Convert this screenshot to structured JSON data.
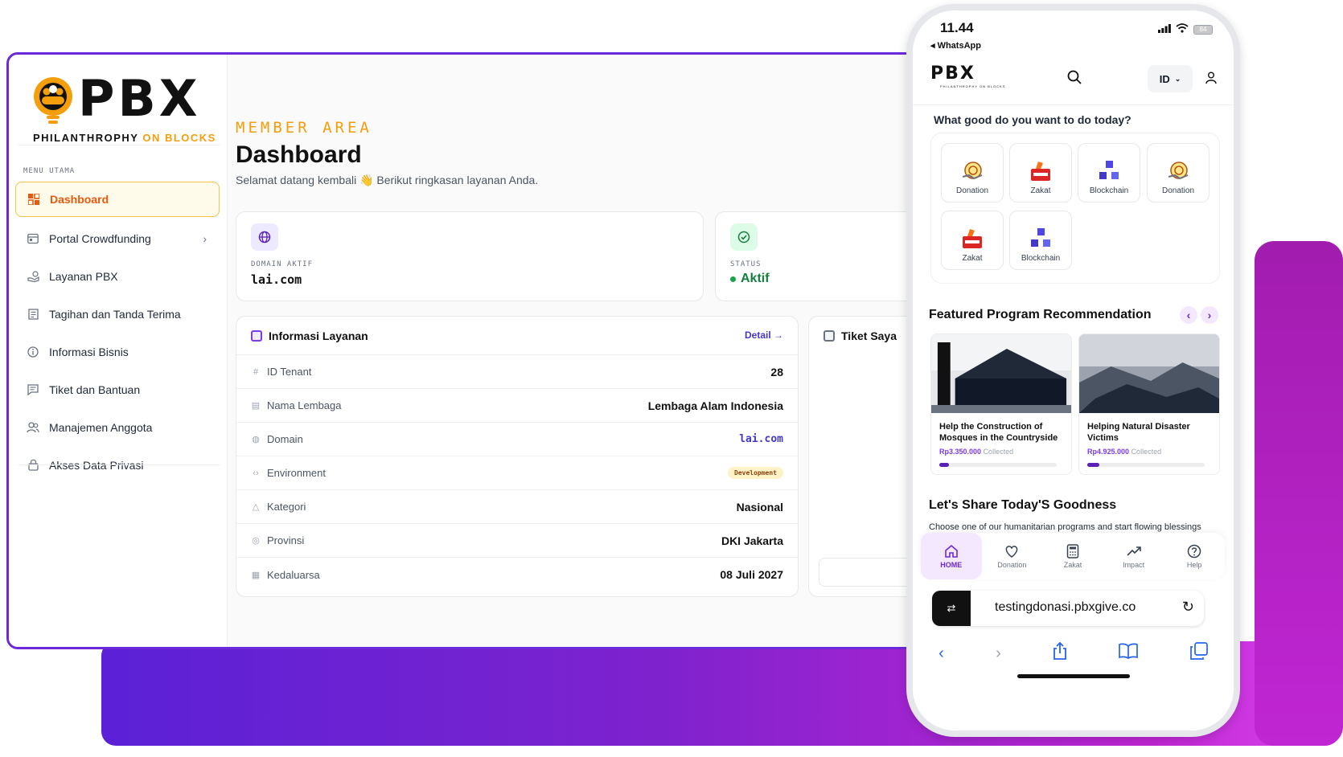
{
  "desktop": {
    "logo": {
      "word": "PBX",
      "tagline_a": "PHILANTHROPHY",
      "tagline_b": "ON BLOCKS"
    },
    "sidebar": {
      "section_title": "MENU UTAMA",
      "items": [
        {
          "label": "Dashboard",
          "icon": "grid-icon"
        },
        {
          "label": "Portal Crowdfunding",
          "icon": "window-icon"
        },
        {
          "label": "Layanan PBX",
          "icon": "hand-coin-icon"
        },
        {
          "label": "Tagihan dan Tanda Terima",
          "icon": "receipt-icon"
        },
        {
          "label": "Informasi Bisnis",
          "icon": "info-icon"
        },
        {
          "label": "Tiket dan Bantuan",
          "icon": "message-icon"
        },
        {
          "label": "Manajemen Anggota",
          "icon": "users-icon"
        },
        {
          "label": "Akses Data Privasi",
          "icon": "lock-icon"
        }
      ]
    },
    "header": {
      "eyebrow": "MEMBER AREA",
      "title": "Dashboard",
      "subtitle": "Selamat datang kembali 👋 Berikut ringkasan layanan Anda."
    },
    "domain_card": {
      "label": "DOMAIN AKTIF",
      "value": "lai.com"
    },
    "status_card": {
      "label": "STATUS",
      "value": "Aktif"
    },
    "service_info": {
      "title": "Informasi Layanan",
      "detail_link": "Detail →",
      "rows": [
        {
          "key": "ID Tenant",
          "value": "28"
        },
        {
          "key": "Nama Lembaga",
          "value": "Lembaga Alam Indonesia"
        },
        {
          "key": "Domain",
          "value": "lai.com"
        },
        {
          "key": "Environment",
          "value": "Development"
        },
        {
          "key": "Kategori",
          "value": "Nasional"
        },
        {
          "key": "Provinsi",
          "value": "DKI Jakarta"
        },
        {
          "key": "Kedaluarsa",
          "value": "08 Juli 2027"
        }
      ]
    },
    "tickets": {
      "title": "Tiket Saya"
    }
  },
  "phone": {
    "status_bar": {
      "time": "11.44",
      "back_app": "◂ WhatsApp",
      "battery": "84"
    },
    "app_logo": "PBX",
    "app_logo_sub": "PHILANTHROPHY ON BLOCKS",
    "language": "ID",
    "question": "What good do you want to do today?",
    "categories": [
      {
        "label": "Donation",
        "icon": "donation-icon"
      },
      {
        "label": "Zakat",
        "icon": "zakat-icon"
      },
      {
        "label": "Blockchain",
        "icon": "blockchain-icon"
      },
      {
        "label": "Donation",
        "icon": "donation-icon"
      },
      {
        "label": "Zakat",
        "icon": "zakat-icon"
      },
      {
        "label": "Blockchain",
        "icon": "blockchain-icon"
      }
    ],
    "featured_title": "Featured Program Recommendation",
    "programs": [
      {
        "title": "Help the Construction of Mosques in the Countryside",
        "amount": "Rp3.350.000",
        "collected": "Collected",
        "progress": 0.08
      },
      {
        "title": "Helping Natural Disaster Victims",
        "amount": "Rp4.925.000",
        "collected": "Collected",
        "progress": 0.1
      }
    ],
    "share_title": "Let's Share Today'S Goodness",
    "share_desc": "Choose one of our humanitarian programs and start flowing blessings",
    "tabs": [
      {
        "label": "HOME",
        "icon": "home-icon"
      },
      {
        "label": "Donation",
        "icon": "heart-icon"
      },
      {
        "label": "Zakat",
        "icon": "calculator-icon"
      },
      {
        "label": "Impact",
        "icon": "trend-icon"
      },
      {
        "label": "Help",
        "icon": "help-icon"
      }
    ],
    "url": "testingdonasi.pbxgive.co"
  },
  "colors": {
    "accent_purple": "#6d28d9",
    "accent_orange": "#f59e0b",
    "status_green": "#15803d"
  }
}
